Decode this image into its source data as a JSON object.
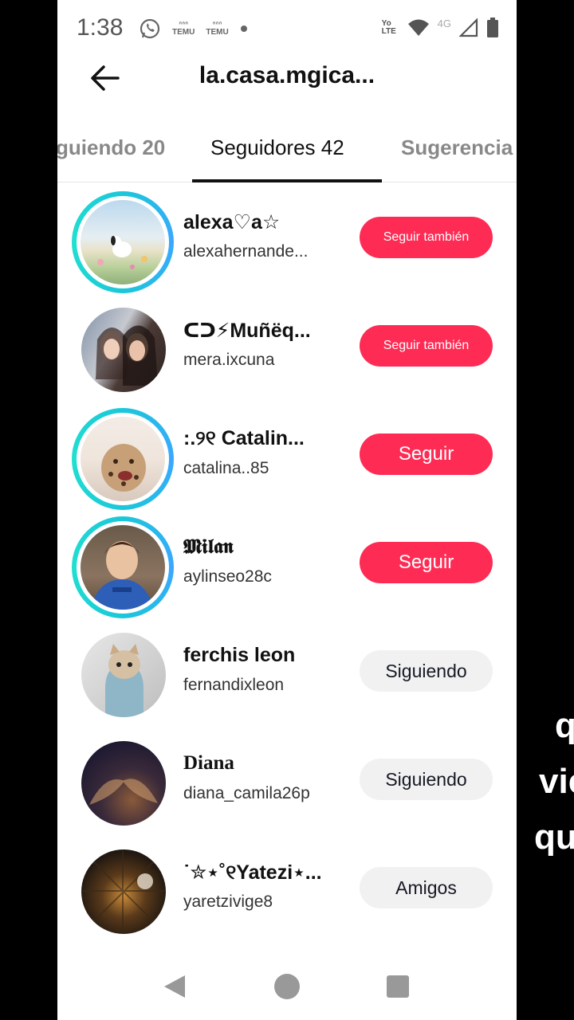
{
  "status_bar": {
    "time": "1:38",
    "icons": [
      "whatsapp-icon",
      "temu-icon",
      "temu-icon",
      "dot-icon"
    ],
    "temu_label": "TEMU",
    "right_icons": [
      "volte-icon",
      "wifi-icon",
      "signal-4g-icon",
      "battery-icon"
    ],
    "volte_label": "Yo LTE",
    "network_label": "4G"
  },
  "header": {
    "title": "la.casa.mgica...",
    "back_icon": "arrow-left-icon"
  },
  "tabs": [
    {
      "label": "guiendo 20",
      "active": false
    },
    {
      "label": "Seguidores 42",
      "active": true
    },
    {
      "label": "Sugerencia",
      "active": false
    }
  ],
  "followers": [
    {
      "name": "alexa♡a☆",
      "handle": "alexahernande...",
      "button": "Seguir también",
      "ring": true
    },
    {
      "name": "ᑕᑐ⚡Muñëq...",
      "handle": "mera.ixcuna",
      "button": "Seguir también",
      "ring": false
    },
    {
      "name": ":.୨୧ Catalin...",
      "handle": "catalina..85",
      "button": "Seguir",
      "ring": true
    },
    {
      "name": "𝕸𝖎𝖑𝖆𝖓",
      "handle": "aylinseo28c",
      "button": "Seguir",
      "ring": true
    },
    {
      "name": "ferchis leon",
      "handle": "fernandixleon",
      "button": "Siguiendo",
      "ring": false
    },
    {
      "name": "Diana",
      "handle": "diana_camila26p",
      "button": "Siguiendo",
      "ring": false
    },
    {
      "name": "˙✮⋆˚୧Yatezi⋆...",
      "handle": "yaretzivige8",
      "button": "Amigos",
      "ring": false
    }
  ],
  "overlay_text": [
    "q",
    "vie",
    "qu"
  ],
  "colors": {
    "accent_red": "#fe2c55",
    "ring": "#1bc7d9",
    "grey_button": "#f1f1f2"
  },
  "navbar": {
    "icons": [
      "nav-back-icon",
      "nav-home-icon",
      "nav-recents-icon"
    ]
  }
}
